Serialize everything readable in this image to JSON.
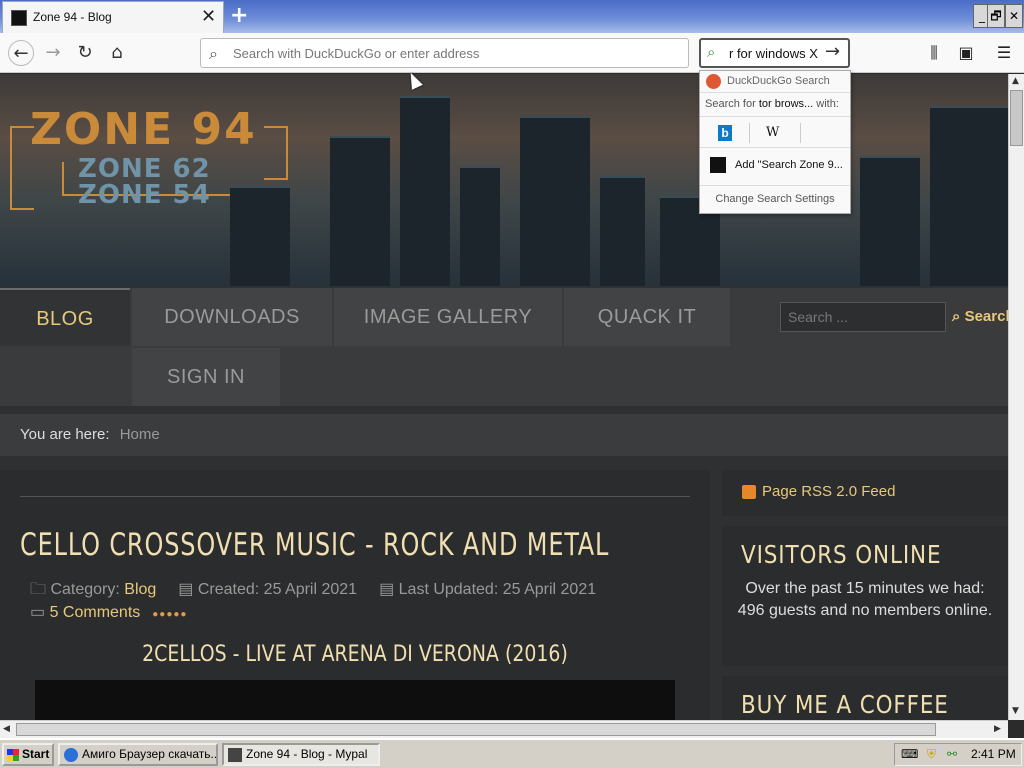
{
  "browser": {
    "tab_title": "Zone 94 - Blog",
    "tab_close": "✕",
    "new_tab": "+",
    "url_placeholder": "Search with DuckDuckGo or enter address",
    "search_value": "r for windows X",
    "window_buttons": [
      "_",
      "🗗",
      "✕"
    ]
  },
  "search_popup": {
    "header": "DuckDuckGo Search",
    "search_for_prefix": "Search for ",
    "search_for_query": "tor brows...",
    "search_for_suffix": " with:",
    "bing_label": "b",
    "wiki_label": "W",
    "add_engine": "Add \"Search Zone 9...",
    "change_settings": "Change Search Settings"
  },
  "site": {
    "logo_main": "ZONE 94",
    "logo_sub1": "ZONE 62",
    "logo_sub2": "ZONE 54",
    "menu": [
      "BLOG",
      "DOWNLOADS",
      "IMAGE GALLERY",
      "QUACK IT",
      "SIGN IN"
    ],
    "search_placeholder": "Search ...",
    "search_button": "Search",
    "breadcrumb_label": "You are here:",
    "breadcrumb_home": "Home"
  },
  "article": {
    "title": "CELLO CROSSOVER MUSIC - ROCK AND METAL",
    "category_label": "Category: ",
    "category": "Blog",
    "created": "Created: 25 April 2021",
    "updated": "Last Updated: 25 April 2021",
    "comments": "5 Comments",
    "video_title": "2CELLOS - LIVE AT ARENA DI VERONA (2016)"
  },
  "sidebar": {
    "rss": "Page RSS 2.0 Feed",
    "visitors_title": "VISITORS ONLINE",
    "visitors_text": "Over the past 15 minutes we had: 496 guests and no members online.",
    "coffee_title": "BUY ME A COFFEE"
  },
  "taskbar": {
    "start": "Start",
    "task1": "Амиго Браузер скачать...",
    "task2": "Zone 94 - Blog - Mypal",
    "time": "2:41 PM"
  },
  "colors": {
    "accent": "#e6c97a",
    "heading": "#f0dfb0",
    "logo": "#c98a3a"
  }
}
